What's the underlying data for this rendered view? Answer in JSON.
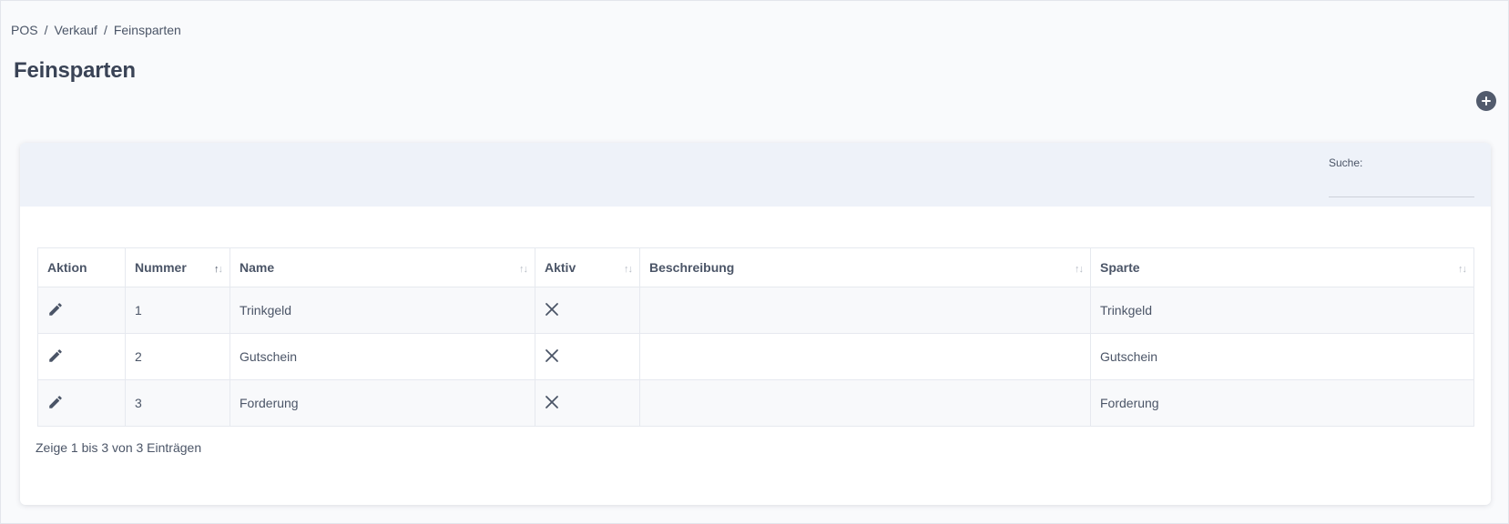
{
  "breadcrumb": {
    "items": [
      "POS",
      "Verkauf",
      "Feinsparten"
    ],
    "separator": "/"
  },
  "page_title": "Feinsparten",
  "add_button": {
    "icon": "plus-circle-icon"
  },
  "search": {
    "label": "Suche:",
    "value": "",
    "placeholder": ""
  },
  "table": {
    "columns": [
      {
        "label": "Aktion",
        "sortable": false
      },
      {
        "label": "Nummer",
        "sortable": true
      },
      {
        "label": "Name",
        "sortable": true
      },
      {
        "label": "Aktiv",
        "sortable": true
      },
      {
        "label": "Beschreibung",
        "sortable": true
      },
      {
        "label": "Sparte",
        "sortable": true
      }
    ],
    "rows": [
      {
        "nummer": "1",
        "name": "Trinkgeld",
        "aktiv": "x-icon",
        "beschreibung": "",
        "sparte": "Trinkgeld"
      },
      {
        "nummer": "2",
        "name": "Gutschein",
        "aktiv": "x-icon",
        "beschreibung": "",
        "sparte": "Gutschein"
      },
      {
        "nummer": "3",
        "name": "Forderung",
        "aktiv": "x-icon",
        "beschreibung": "",
        "sparte": "Forderung"
      }
    ]
  },
  "info": "Zeige 1 bis 3 von 3 Einträgen",
  "colors": {
    "accent": "#525b6d",
    "header_bg": "#eef2f9",
    "page_bg": "#f9fafc"
  }
}
